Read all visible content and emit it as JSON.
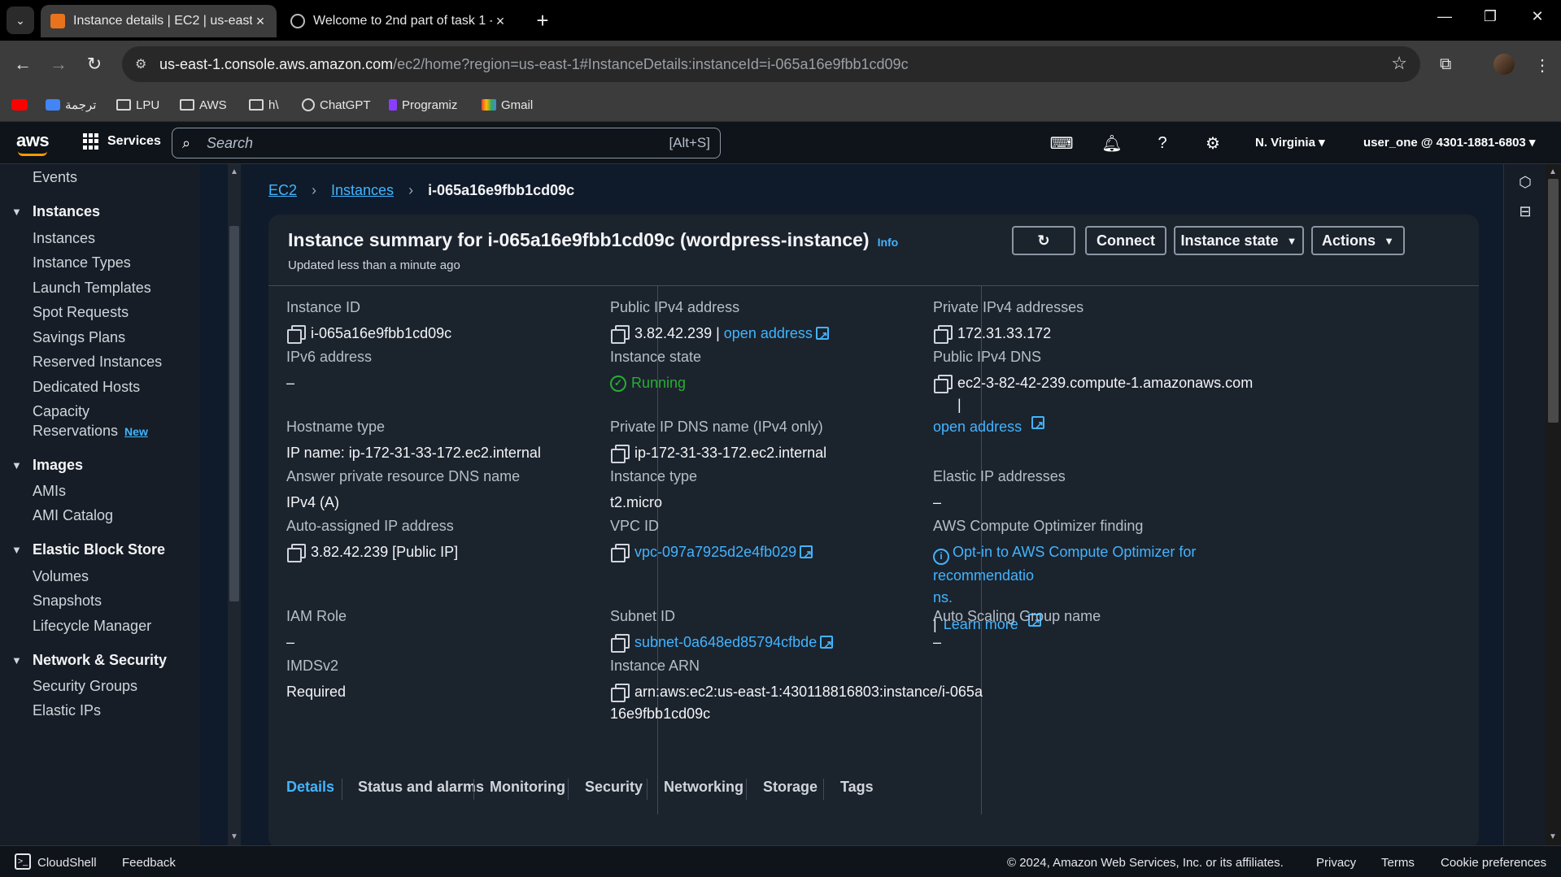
{
  "browser": {
    "tabs": [
      {
        "title": "Instance details | EC2 | us-east-",
        "active": true
      },
      {
        "title": "Welcome to 2nd part of task 1 -",
        "active": false
      }
    ],
    "url_host": "us-east-1.console.aws.amazon.com",
    "url_path": "/ec2/home?region=us-east-1#InstanceDetails:instanceId=i-065a16e9fbb1cd09c",
    "bookmarks": [
      {
        "label": "",
        "icon": "youtube-icon"
      },
      {
        "label": "ترجمة",
        "icon": "translate-icon"
      },
      {
        "label": "LPU",
        "icon": "folder-icon"
      },
      {
        "label": "AWS",
        "icon": "folder-icon"
      },
      {
        "label": "h\\",
        "icon": "folder-icon"
      },
      {
        "label": "ChatGPT",
        "icon": "chatgpt-icon"
      },
      {
        "label": "Programiz",
        "icon": "programiz-icon"
      },
      {
        "label": "Gmail",
        "icon": "gmail-icon"
      }
    ]
  },
  "aws_nav": {
    "logo": "aws",
    "services": "Services",
    "search_placeholder": "Search",
    "search_shortcut": "[Alt+S]",
    "region": "N. Virginia",
    "account": "user_one @ 4301-1881-6803"
  },
  "sidebar": {
    "items": [
      {
        "type": "item",
        "label": "Events"
      },
      {
        "type": "head",
        "label": "Instances"
      },
      {
        "type": "item",
        "label": "Instances"
      },
      {
        "type": "item",
        "label": "Instance Types"
      },
      {
        "type": "item",
        "label": "Launch Templates"
      },
      {
        "type": "item",
        "label": "Spot Requests"
      },
      {
        "type": "item",
        "label": "Savings Plans"
      },
      {
        "type": "item",
        "label": "Reserved Instances"
      },
      {
        "type": "item",
        "label": "Dedicated Hosts"
      },
      {
        "type": "item",
        "label": "Capacity"
      },
      {
        "type": "item",
        "label": "Reservations"
      },
      {
        "type": "head",
        "label": "Images"
      },
      {
        "type": "item",
        "label": "AMIs"
      },
      {
        "type": "item",
        "label": "AMI Catalog"
      },
      {
        "type": "head",
        "label": "Elastic Block Store"
      },
      {
        "type": "item",
        "label": "Volumes"
      },
      {
        "type": "item",
        "label": "Snapshots"
      },
      {
        "type": "item",
        "label": "Lifecycle Manager"
      },
      {
        "type": "head",
        "label": "Network & Security"
      },
      {
        "type": "item",
        "label": "Security Groups"
      },
      {
        "type": "item",
        "label": "Elastic IPs"
      }
    ],
    "new_badge": "New"
  },
  "breadcrumb": {
    "ec2": "EC2",
    "instances": "Instances",
    "current": "i-065a16e9fbb1cd09c"
  },
  "summary": {
    "title": "Instance summary for i-065a16e9fbb1cd09c (wordpress-instance)",
    "info": "Info",
    "updated": "Updated less than a minute ago",
    "buttons": {
      "connect": "Connect",
      "instance_state": "Instance state",
      "actions": "Actions"
    },
    "fields": {
      "instance_id_label": "Instance ID",
      "instance_id": "i-065a16e9fbb1cd09c",
      "public_ipv4_label": "Public IPv4 address",
      "public_ipv4": "3.82.42.239",
      "open_address": "open address",
      "private_ipv4_label": "Private IPv4 addresses",
      "private_ipv4": "172.31.33.172",
      "ipv6_label": "IPv6 address",
      "ipv6": "–",
      "instance_state_label": "Instance state",
      "instance_state": "Running",
      "public_dns_label": "Public IPv4 DNS",
      "public_dns": "ec2-3-82-42-239.compute-1.amazonaws.com",
      "hostname_type_label": "Hostname type",
      "hostname_type": "IP name: ip-172-31-33-172.ec2.internal",
      "private_dns_label": "Private IP DNS name (IPv4 only)",
      "private_dns": "ip-172-31-33-172.ec2.internal",
      "answer_dns_label": "Answer private resource DNS name",
      "answer_dns": "IPv4 (A)",
      "instance_type_label": "Instance type",
      "instance_type": "t2.micro",
      "elastic_ip_label": "Elastic IP addresses",
      "elastic_ip": "–",
      "auto_ip_label": "Auto-assigned IP address",
      "auto_ip": "3.82.42.239 [Public IP]",
      "vpc_label": "VPC ID",
      "vpc": "vpc-097a7925d2e4fb029",
      "optimizer_label": "AWS Compute Optimizer finding",
      "optimizer_line1": "Opt-in to AWS Compute Optimizer for recommendatio",
      "optimizer_line2": "ns.",
      "learn_more": "Learn more",
      "iam_label": "IAM Role",
      "iam": "–",
      "subnet_label": "Subnet ID",
      "subnet": "subnet-0a648ed85794cfbde",
      "asg_label": "Auto Scaling Group name",
      "asg": "–",
      "imds_label": "IMDSv2",
      "imds": "Required",
      "arn_label": "Instance ARN",
      "arn_line1": "arn:aws:ec2:us-east-1:430118816803:instance/i-065a",
      "arn_line2": "16e9fbb1cd09c"
    },
    "tabs": [
      "Details",
      "Status and alarms",
      "Monitoring",
      "Security",
      "Networking",
      "Storage",
      "Tags"
    ]
  },
  "footer": {
    "cloudshell": "CloudShell",
    "feedback": "Feedback",
    "copyright": "© 2024, Amazon Web Services, Inc. or its affiliates.",
    "privacy": "Privacy",
    "terms": "Terms",
    "cookies": "Cookie preferences"
  },
  "colors": {
    "link": "#42b4ff",
    "running": "#29ad32",
    "aws_orange": "#ff9900"
  }
}
